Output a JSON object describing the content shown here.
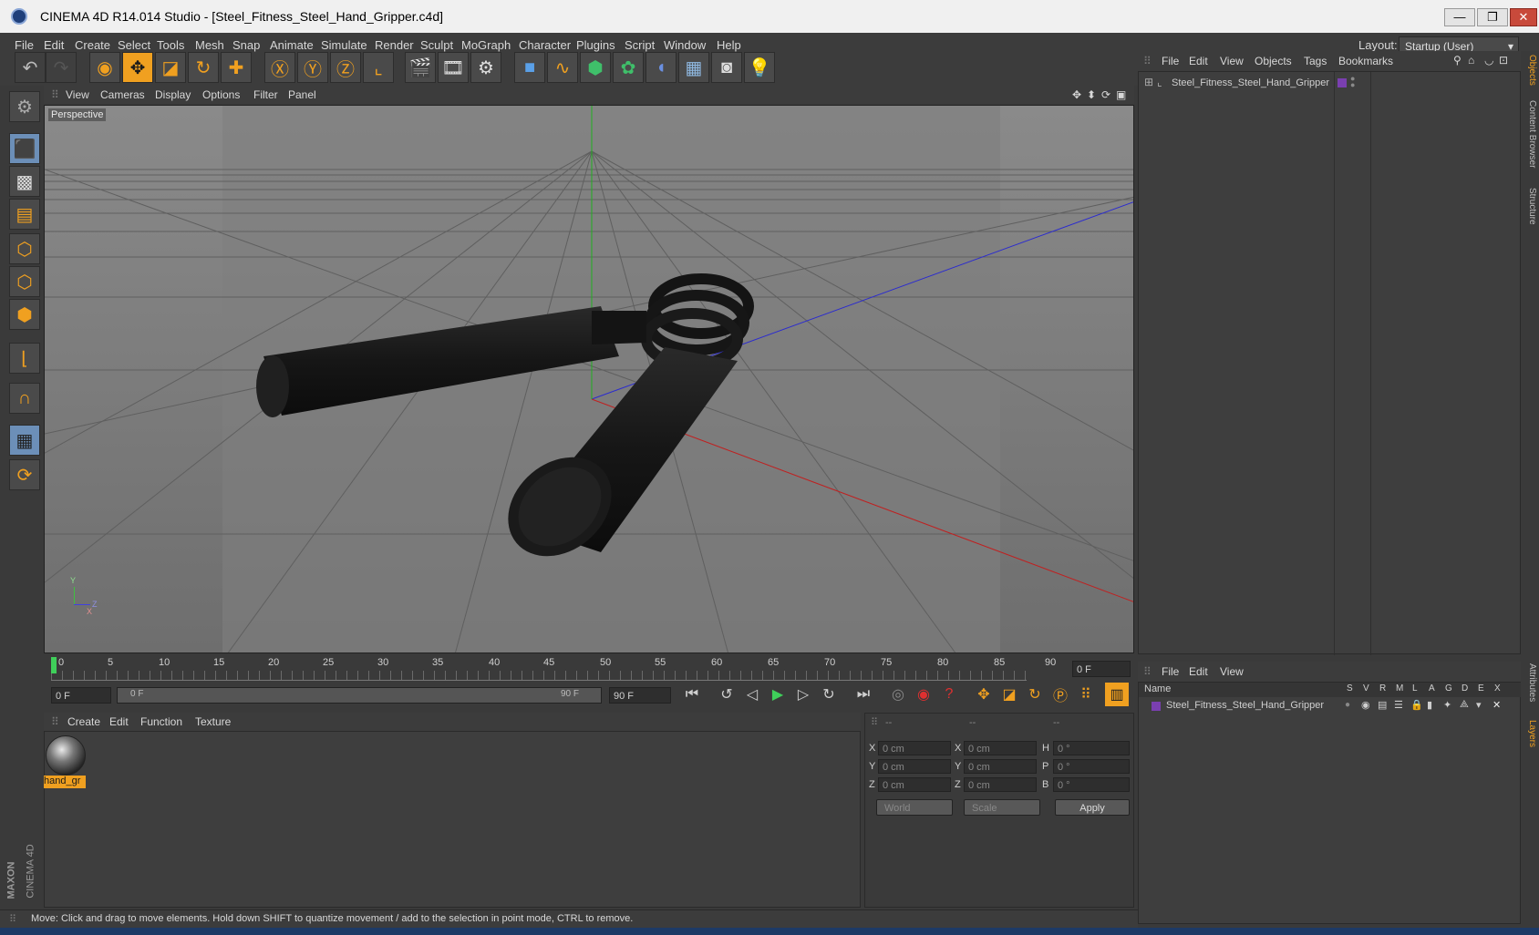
{
  "window": {
    "title": "CINEMA 4D R14.014 Studio - [Steel_Fitness_Steel_Hand_Gripper.c4d]",
    "minimize": "—",
    "restore": "❐",
    "close": "✕"
  },
  "menubar": {
    "items": [
      "File",
      "Edit",
      "Create",
      "Select",
      "Tools",
      "Mesh",
      "Snap",
      "Animate",
      "Simulate",
      "Render",
      "Sculpt",
      "MoGraph",
      "Character",
      "Plugins",
      "Script",
      "Window",
      "Help"
    ],
    "layout_label": "Layout:",
    "layout_value": "Startup (User)"
  },
  "viewport": {
    "menu": [
      "View",
      "Cameras",
      "Display",
      "Options",
      "Filter",
      "Panel"
    ],
    "camera_label": "Perspective",
    "axis_y": "Y",
    "axis_x": "X",
    "axis_z": "Z"
  },
  "timeline": {
    "ticks": [
      "0",
      "5",
      "10",
      "15",
      "20",
      "25",
      "30",
      "35",
      "40",
      "45",
      "50",
      "55",
      "60",
      "65",
      "70",
      "75",
      "80",
      "85",
      "90"
    ],
    "current_frame": "0 F",
    "start_field": "0 F",
    "range_start": "0 F",
    "range_end": "90 F",
    "end_field": "90 F"
  },
  "materials": {
    "menu": [
      "Create",
      "Edit",
      "Function",
      "Texture"
    ],
    "items": [
      {
        "name": "hand_gr"
      }
    ]
  },
  "coordinates": {
    "headers": [
      "--",
      "--",
      "--"
    ],
    "rows": [
      {
        "a_label": "X",
        "a_value": "0 cm",
        "b_label": "X",
        "b_value": "0 cm",
        "c_label": "H",
        "c_value": "0 °"
      },
      {
        "a_label": "Y",
        "a_value": "0 cm",
        "b_label": "Y",
        "b_value": "0 cm",
        "c_label": "P",
        "c_value": "0 °"
      },
      {
        "a_label": "Z",
        "a_value": "0 cm",
        "b_label": "Z",
        "b_value": "0 cm",
        "c_label": "B",
        "c_value": "0 °"
      }
    ],
    "mode_select": "World",
    "type_select": "Scale",
    "apply_label": "Apply"
  },
  "objects_panel": {
    "menu": [
      "File",
      "Edit",
      "View",
      "Objects",
      "Tags",
      "Bookmarks"
    ],
    "items": [
      {
        "name": "Steel_Fitness_Steel_Hand_Gripper"
      }
    ]
  },
  "layers_panel": {
    "menu": [
      "File",
      "Edit",
      "View"
    ],
    "columns": [
      "Name",
      "S",
      "V",
      "R",
      "M",
      "L",
      "A",
      "G",
      "D",
      "E",
      "X"
    ],
    "items": [
      {
        "name": "Steel_Fitness_Steel_Hand_Gripper"
      }
    ]
  },
  "side_tabs": [
    "Objects",
    "Content Browser",
    "Structure",
    "Attributes",
    "Layers"
  ],
  "status": "Move: Click and drag to move elements. Hold down SHIFT to quantize movement / add to the selection in point mode, CTRL to remove.",
  "brand": {
    "maxon": "MAXON",
    "cinema": "CINEMA 4D"
  },
  "colors": {
    "accent": "#f0a020",
    "viewport_bg": "#7a7a7a",
    "panel_bg": "#3e3e3e",
    "object_tag": "#7a3fb0"
  }
}
